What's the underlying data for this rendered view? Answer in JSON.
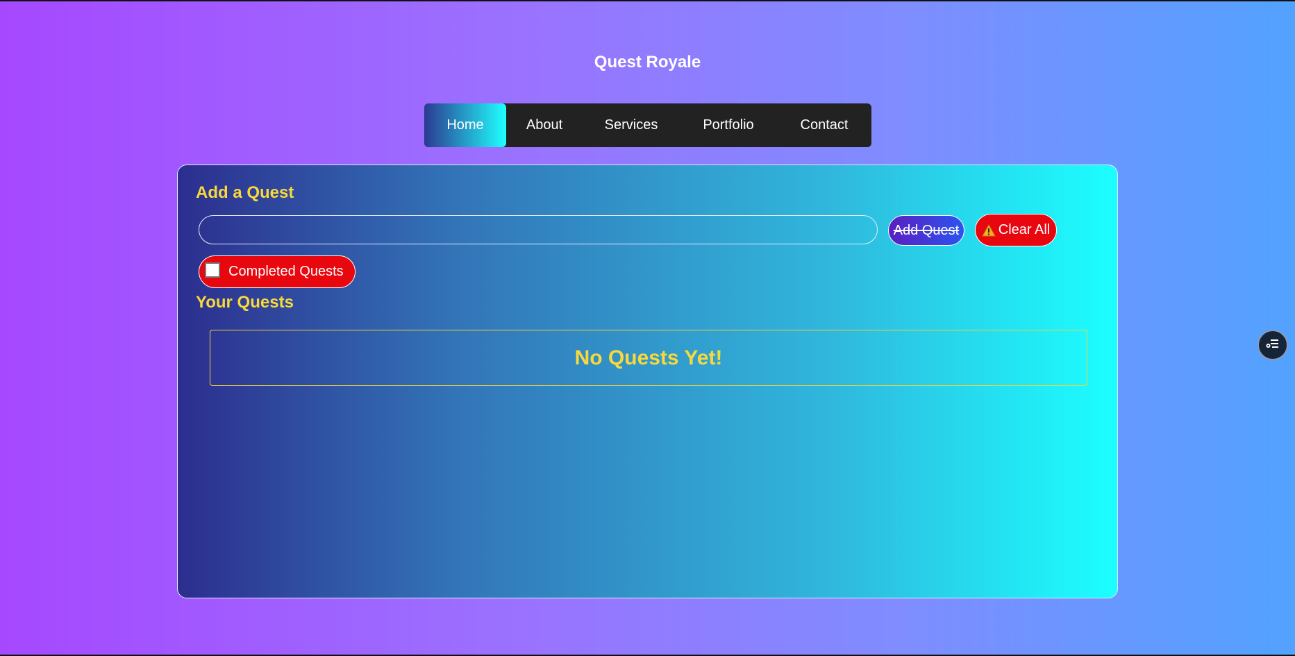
{
  "app": {
    "title": "Quest Royale"
  },
  "nav": {
    "items": [
      {
        "label": "Home",
        "active": true
      },
      {
        "label": "About",
        "active": false
      },
      {
        "label": "Services",
        "active": false
      },
      {
        "label": "Portfolio",
        "active": false
      },
      {
        "label": "Contact",
        "active": false
      }
    ]
  },
  "add_section": {
    "title": "Add a Quest",
    "input_value": "",
    "input_placeholder": "",
    "add_button_label": "Add Quest",
    "clear_button_label": "Clear All",
    "clear_button_icon": "warning-icon",
    "completed_toggle_label": "Completed Quests",
    "completed_checked": false
  },
  "quests_section": {
    "title": "Your Quests",
    "empty_message": "No Quests Yet!",
    "items": []
  },
  "floating_button": {
    "icon": "menu-list-icon"
  },
  "colors": {
    "accent_yellow": "#f9d93a",
    "danger_red": "#e8070f",
    "nav_background": "#222222"
  }
}
